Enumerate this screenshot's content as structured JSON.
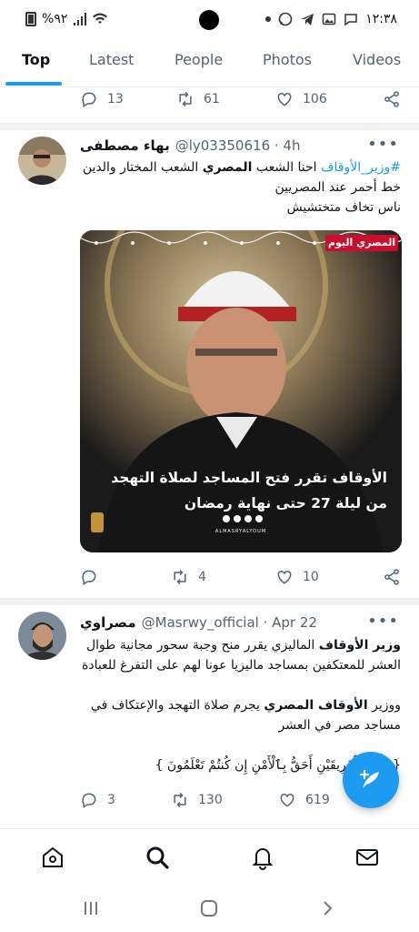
{
  "status_bar": {
    "battery_text": "%٩٢",
    "time": "١٢:٣٨",
    "left_icons": [
      "battery-icon",
      "signal-icon",
      "wifi-icon"
    ],
    "right_icons": [
      "dot-icon",
      "whatsapp-icon",
      "telegram-icon",
      "gallery-icon",
      "chat-icon"
    ]
  },
  "tabs": [
    {
      "label": "Top",
      "active": true
    },
    {
      "label": "Latest",
      "active": false
    },
    {
      "label": "People",
      "active": false
    },
    {
      "label": "Photos",
      "active": false
    },
    {
      "label": "Videos",
      "active": false
    }
  ],
  "prev_tweet_actions": {
    "replies": "13",
    "retweets": "61",
    "likes": "106"
  },
  "tweets": [
    {
      "name": "بهاء مصطفى",
      "handle": "@ly03350616 · 4h",
      "text_hashtag": "#وزير_الأوقاف",
      "text_line1_rest": " احنا الشعب ",
      "text_line1_bold": "المصري",
      "text_line1_end": " الشعب المختار والدين",
      "text_line2": "خط أحمر عند المصريين",
      "text_line3": "ناس تخاف متختشيش",
      "media": {
        "logo_text": "المصري اليوم",
        "caption_line1": "الأوقاف تقرر فتح المساجد لصلاة التهجد",
        "caption_line2": "من ليلة 27 حتى نهاية رمضان",
        "footer_text": "ALMASRYALYOUM"
      },
      "actions": {
        "replies": "",
        "retweets": "4",
        "likes": "10"
      }
    },
    {
      "name": "مصراوي",
      "handle": "@Masrwy_official · Apr 22",
      "p1_bold": "وزير الأوقاف",
      "p1_rest": " الماليزي يقرر منح وجبة سحور مجانية طوال",
      "p1_line2": "العشر للمعتكفين بمساجد ماليزيا عونا لهم على التفرغ للعبادة",
      "p2_start": "ووزير ",
      "p2_bold": "الأوقاف المصري",
      "p2_rest": " يجرم صلاة التهجد والإعتكاف في",
      "p2_line2": "مساجد مصر في العشر",
      "quote": "{ فَأَيُّ ٱلْفَرِيقَيْنِ أَحَقُّ بِٱلْأَمْنِ إِن كُنتُمْ تَعْلَمُونَ }",
      "actions": {
        "replies": "3",
        "retweets": "130",
        "likes": "619"
      }
    }
  ],
  "fab": {
    "icon": "compose-tweet-icon"
  },
  "bottom_nav": [
    "home-icon",
    "search-icon",
    "notifications-icon",
    "messages-icon"
  ],
  "system_nav": [
    "recents-icon",
    "home-button-icon",
    "back-icon"
  ],
  "colors": {
    "accent": "#1d9bf0",
    "text": "#0f1419",
    "muted": "#536471"
  }
}
